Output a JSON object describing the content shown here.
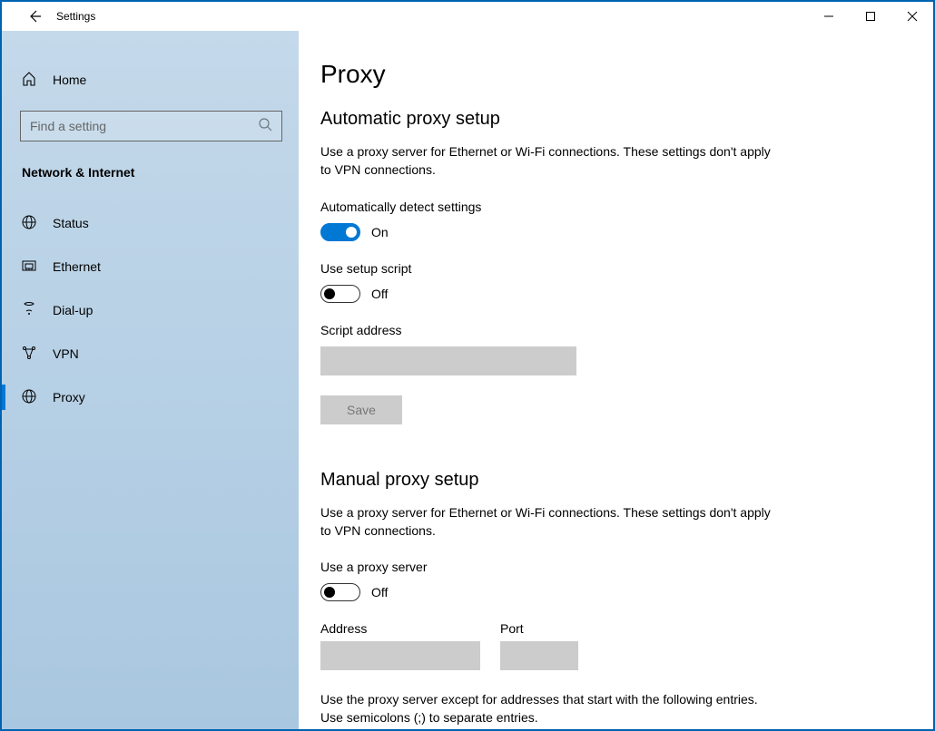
{
  "app": {
    "title": "Settings"
  },
  "sidebar": {
    "home_label": "Home",
    "search_placeholder": "Find a setting",
    "category": "Network & Internet",
    "items": [
      {
        "icon": "globe-icon",
        "label": "Status"
      },
      {
        "icon": "ethernet-icon",
        "label": "Ethernet"
      },
      {
        "icon": "dialup-icon",
        "label": "Dial-up"
      },
      {
        "icon": "vpn-icon",
        "label": "VPN"
      },
      {
        "icon": "globe-icon",
        "label": "Proxy"
      }
    ],
    "active_index": 4
  },
  "main": {
    "title": "Proxy",
    "auto": {
      "heading": "Automatic proxy setup",
      "desc": "Use a proxy server for Ethernet or Wi-Fi connections. These settings don't apply to VPN connections.",
      "detect_label": "Automatically detect settings",
      "detect_state": "On",
      "script_label": "Use setup script",
      "script_state": "Off",
      "script_addr_label": "Script address",
      "script_addr_value": "",
      "save_label": "Save"
    },
    "manual": {
      "heading": "Manual proxy setup",
      "desc": "Use a proxy server for Ethernet or Wi-Fi connections. These settings don't apply to VPN connections.",
      "use_label": "Use a proxy server",
      "use_state": "Off",
      "address_label": "Address",
      "address_value": "",
      "port_label": "Port",
      "port_value": "",
      "exceptions_desc": "Use the proxy server except for addresses that start with the following entries. Use semicolons (;) to separate entries."
    }
  }
}
